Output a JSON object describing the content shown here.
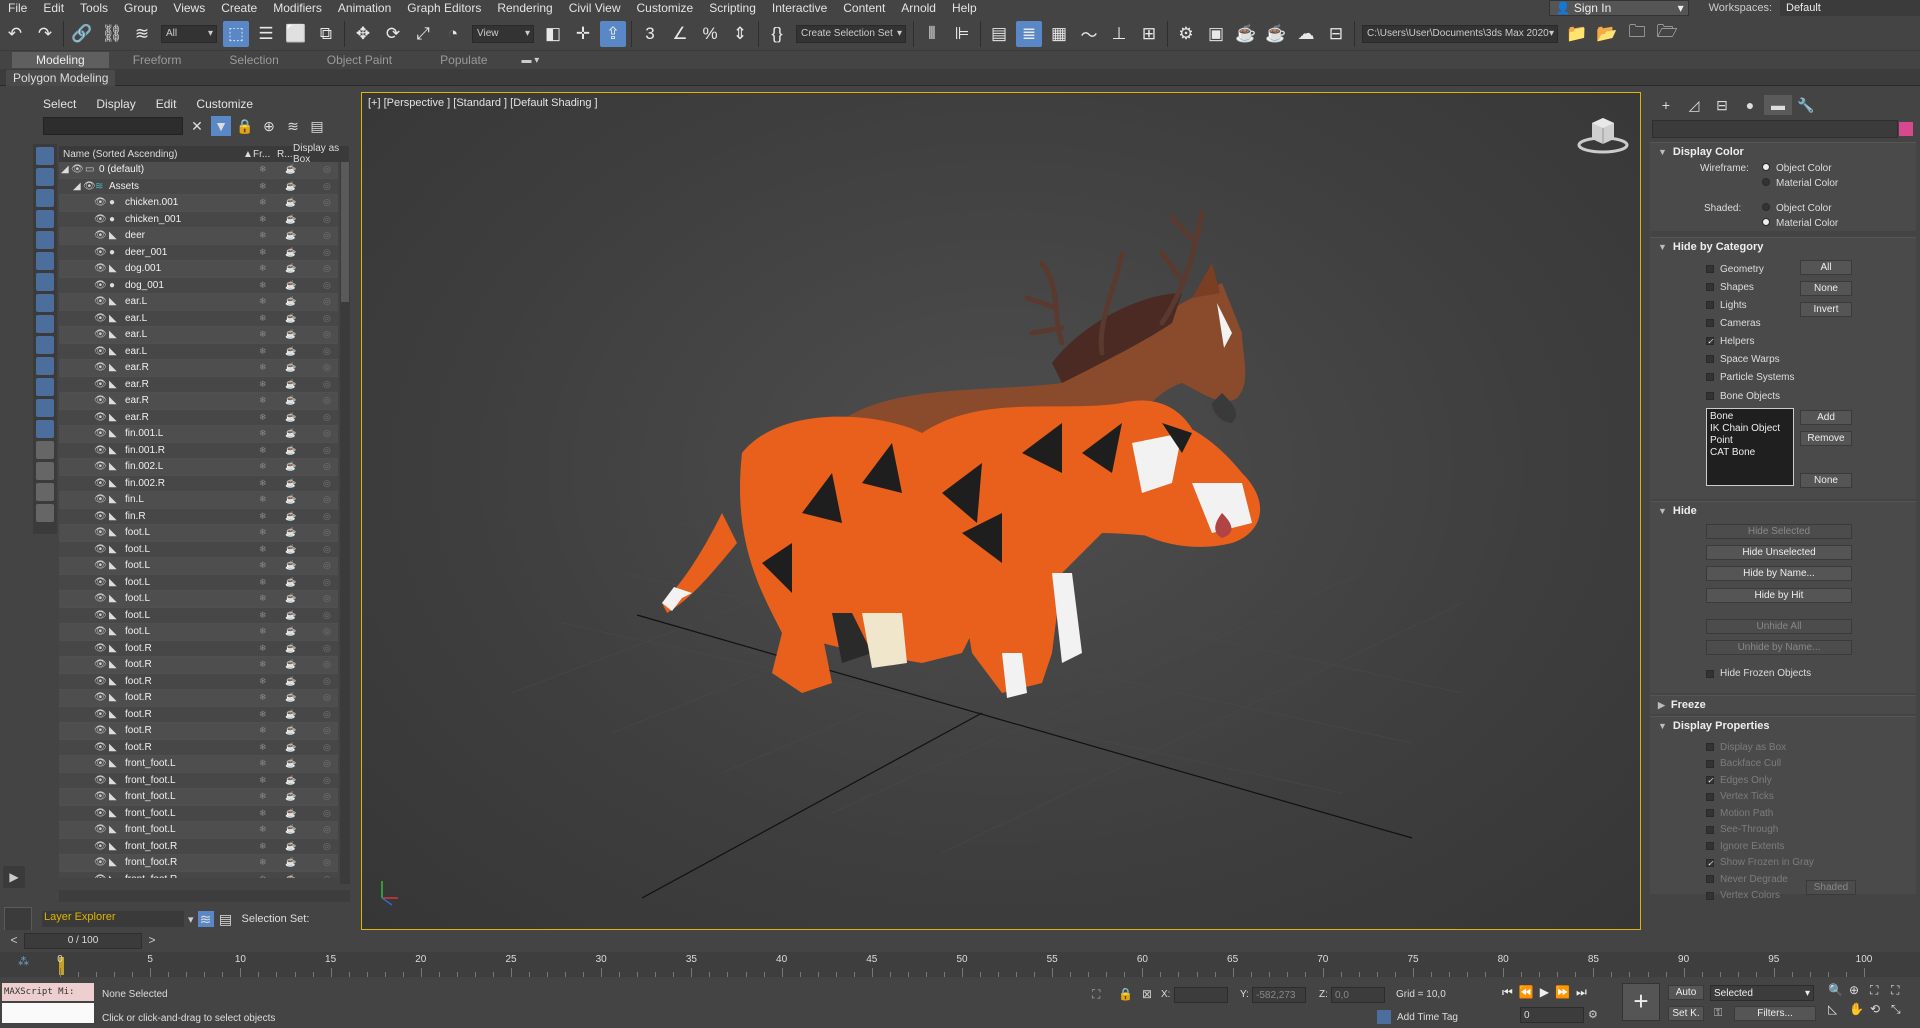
{
  "menubar": {
    "items": [
      "File",
      "Edit",
      "Tools",
      "Group",
      "Views",
      "Create",
      "Modifiers",
      "Animation",
      "Graph Editors",
      "Rendering",
      "Civil View",
      "Customize",
      "Scripting",
      "Interactive",
      "Content",
      "Arnold",
      "Help"
    ],
    "sign_in": "Sign In",
    "workspaces_label": "Workspaces:",
    "workspaces_value": "Default"
  },
  "toolbar": {
    "filter_dropdown": "All",
    "view_dropdown": "View",
    "selection_set": "Create Selection Set",
    "path": "C:\\Users\\User\\Documents\\3ds Max 2020"
  },
  "ribbon": {
    "tabs": [
      "Modeling",
      "Freeform",
      "Selection",
      "Object Paint",
      "Populate"
    ],
    "active_tab": "Modeling",
    "panel": "Polygon Modeling"
  },
  "scene_explorer": {
    "menu": [
      "Select",
      "Display",
      "Edit",
      "Customize"
    ],
    "columns": {
      "name": "Name (Sorted Ascending)",
      "frozen": "Fr...",
      "render": "R...",
      "box": "Display as Box"
    },
    "rows": [
      {
        "name": "0 (default)",
        "indent": 0,
        "type": "layer"
      },
      {
        "name": "Assets",
        "indent": 1,
        "type": "layer"
      },
      {
        "name": "chicken.001",
        "indent": 2,
        "type": "geo"
      },
      {
        "name": "chicken_001",
        "indent": 2,
        "type": "geo"
      },
      {
        "name": "deer",
        "indent": 2,
        "type": "bone"
      },
      {
        "name": "deer_001",
        "indent": 2,
        "type": "geo"
      },
      {
        "name": "dog.001",
        "indent": 2,
        "type": "bone"
      },
      {
        "name": "dog_001",
        "indent": 2,
        "type": "geo"
      },
      {
        "name": "ear.L",
        "indent": 2,
        "type": "bone"
      },
      {
        "name": "ear.L",
        "indent": 2,
        "type": "bone"
      },
      {
        "name": "ear.L",
        "indent": 2,
        "type": "bone"
      },
      {
        "name": "ear.L",
        "indent": 2,
        "type": "bone"
      },
      {
        "name": "ear.R",
        "indent": 2,
        "type": "bone"
      },
      {
        "name": "ear.R",
        "indent": 2,
        "type": "bone"
      },
      {
        "name": "ear.R",
        "indent": 2,
        "type": "bone"
      },
      {
        "name": "ear.R",
        "indent": 2,
        "type": "bone"
      },
      {
        "name": "fin.001.L",
        "indent": 2,
        "type": "bone"
      },
      {
        "name": "fin.001.R",
        "indent": 2,
        "type": "bone"
      },
      {
        "name": "fin.002.L",
        "indent": 2,
        "type": "bone"
      },
      {
        "name": "fin.002.R",
        "indent": 2,
        "type": "bone"
      },
      {
        "name": "fin.L",
        "indent": 2,
        "type": "bone"
      },
      {
        "name": "fin.R",
        "indent": 2,
        "type": "bone"
      },
      {
        "name": "foot.L",
        "indent": 2,
        "type": "bone"
      },
      {
        "name": "foot.L",
        "indent": 2,
        "type": "bone"
      },
      {
        "name": "foot.L",
        "indent": 2,
        "type": "bone"
      },
      {
        "name": "foot.L",
        "indent": 2,
        "type": "bone"
      },
      {
        "name": "foot.L",
        "indent": 2,
        "type": "bone"
      },
      {
        "name": "foot.L",
        "indent": 2,
        "type": "bone"
      },
      {
        "name": "foot.L",
        "indent": 2,
        "type": "bone"
      },
      {
        "name": "foot.R",
        "indent": 2,
        "type": "bone"
      },
      {
        "name": "foot.R",
        "indent": 2,
        "type": "bone"
      },
      {
        "name": "foot.R",
        "indent": 2,
        "type": "bone"
      },
      {
        "name": "foot.R",
        "indent": 2,
        "type": "bone"
      },
      {
        "name": "foot.R",
        "indent": 2,
        "type": "bone"
      },
      {
        "name": "foot.R",
        "indent": 2,
        "type": "bone"
      },
      {
        "name": "foot.R",
        "indent": 2,
        "type": "bone"
      },
      {
        "name": "front_foot.L",
        "indent": 2,
        "type": "bone"
      },
      {
        "name": "front_foot.L",
        "indent": 2,
        "type": "bone"
      },
      {
        "name": "front_foot.L",
        "indent": 2,
        "type": "bone"
      },
      {
        "name": "front_foot.L",
        "indent": 2,
        "type": "bone"
      },
      {
        "name": "front_foot.L",
        "indent": 2,
        "type": "bone"
      },
      {
        "name": "front_foot.R",
        "indent": 2,
        "type": "bone"
      },
      {
        "name": "front_foot.R",
        "indent": 2,
        "type": "bone"
      },
      {
        "name": "front_foot.R",
        "indent": 2,
        "type": "bone"
      }
    ],
    "layer_explorer": "Layer Explorer",
    "selection_set_label": "Selection Set:"
  },
  "viewport": {
    "label": "[+] [Perspective ] [Standard ] [Default Shading ]"
  },
  "command_panel": {
    "display_color": {
      "title": "Display Color",
      "wireframe_label": "Wireframe:",
      "shaded_label": "Shaded:",
      "object_color": "Object Color",
      "material_color": "Material Color"
    },
    "hide_by_category": {
      "title": "Hide by Category",
      "items": [
        "Geometry",
        "Shapes",
        "Lights",
        "Cameras",
        "Helpers",
        "Space Warps",
        "Particle Systems",
        "Bone Objects"
      ],
      "checked": [
        "Helpers"
      ],
      "btn_all": "All",
      "btn_none": "None",
      "btn_invert": "Invert",
      "list": [
        "Bone",
        "IK Chain Object",
        "Point",
        "CAT Bone"
      ],
      "btn_add": "Add",
      "btn_remove": "Remove",
      "btn_none2": "None"
    },
    "hide": {
      "title": "Hide",
      "hide_selected": "Hide Selected",
      "hide_unselected": "Hide Unselected",
      "hide_by_name": "Hide by Name...",
      "hide_by_hit": "Hide by Hit",
      "unhide_all": "Unhide All",
      "unhide_by_name": "Unhide by Name...",
      "hide_frozen": "Hide Frozen Objects"
    },
    "freeze": {
      "title": "Freeze"
    },
    "display_properties": {
      "title": "Display Properties",
      "items": [
        "Display as Box",
        "Backface Cull",
        "Edges Only",
        "Vertex Ticks",
        "Motion Path",
        "See-Through",
        "Ignore Extents",
        "Show Frozen in Gray",
        "Never Degrade",
        "Vertex Colors"
      ],
      "checked": [
        "Edges Only",
        "Show Frozen in Gray"
      ],
      "shaded_btn": "Shaded"
    }
  },
  "timeline": {
    "frame": "0 / 100",
    "ticks": [
      "0",
      "5",
      "10",
      "15",
      "20",
      "25",
      "30",
      "35",
      "40",
      "45",
      "50",
      "55",
      "60",
      "65",
      "70",
      "75",
      "80",
      "85",
      "90",
      "95",
      "100"
    ]
  },
  "status": {
    "maxscript": "MAXScript Mi:",
    "selected": "None Selected",
    "prompt": "Click or click-and-drag to select objects",
    "x_label": "X:",
    "x_value": "",
    "y_label": "Y:",
    "y_value": "-582,273",
    "z_label": "Z:",
    "z_value": "0,0",
    "grid": "Grid = 10,0",
    "add_time_tag": "Add Time Tag",
    "frame_field": "0",
    "auto": "Auto",
    "selected_dropdown": "Selected",
    "set_k": "Set K.",
    "filters": "Filters..."
  }
}
